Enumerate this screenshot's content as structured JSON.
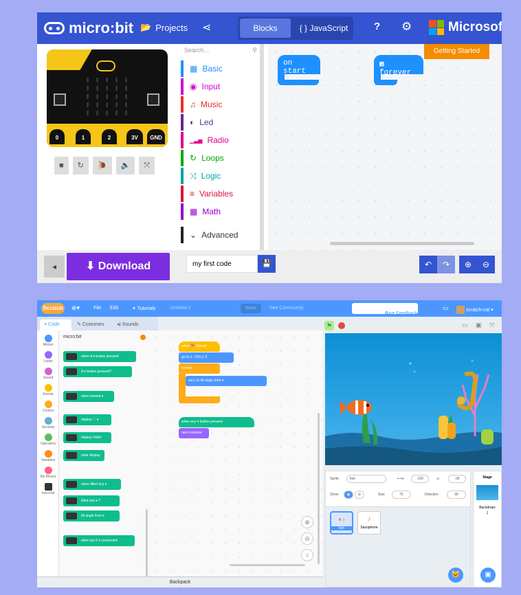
{
  "microbit": {
    "logo": "micro:bit",
    "projects": "Projects",
    "blocks_tab": "Blocks",
    "js_tab": "{ } JavaScript",
    "microsoft": "Microsoft",
    "search_placeholder": "Search...",
    "categories": [
      {
        "label": "Basic",
        "color": "#1e90ff",
        "icon": "▦"
      },
      {
        "label": "Input",
        "color": "#d400d4",
        "icon": "◉"
      },
      {
        "label": "Music",
        "color": "#e63022",
        "icon": "♫"
      },
      {
        "label": "Led",
        "color": "#5c2d91",
        "icon": "◐"
      },
      {
        "label": "Radio",
        "color": "#e3008c",
        "icon": "▁▃▅"
      },
      {
        "label": "Loops",
        "color": "#00aa00",
        "icon": "↻"
      },
      {
        "label": "Logic",
        "color": "#00a4a6",
        "icon": "⤨"
      },
      {
        "label": "Variables",
        "color": "#dc143c",
        "icon": "≡"
      },
      {
        "label": "Math",
        "color": "#9400d3",
        "icon": "▦"
      },
      {
        "label": "Advanced",
        "color": "#444444",
        "icon": "⌄"
      }
    ],
    "on_start": "on start",
    "forever": "forever",
    "getting_started": "Getting Started",
    "download": "⬇ Download",
    "project_name": "my first code",
    "pins": [
      "0",
      "1",
      "2",
      "3V",
      "GND"
    ]
  },
  "scratch": {
    "logo": "Scratch",
    "menu": {
      "file": "File",
      "edit": "Edit",
      "tutorials": "Tutorials",
      "title": "Untitled-1",
      "share": "Share",
      "community": "See Community",
      "feedback": "Give Feedback",
      "user": "scratch-cat"
    },
    "tabs": {
      "code": "Code",
      "costumes": "Costumes",
      "sounds": "Sounds"
    },
    "categories": [
      {
        "label": "Motion",
        "color": "#4c97ff"
      },
      {
        "label": "Looks",
        "color": "#9966ff"
      },
      {
        "label": "Sound",
        "color": "#cf63cf"
      },
      {
        "label": "Events",
        "color": "#ffbf00"
      },
      {
        "label": "Control",
        "color": "#ffab19"
      },
      {
        "label": "Sensing",
        "color": "#5cb1d6"
      },
      {
        "label": "Operators",
        "color": "#59c059"
      },
      {
        "label": "Variables",
        "color": "#ff8c1a"
      },
      {
        "label": "My Blocks",
        "color": "#ff6680"
      },
      {
        "label": "micro:bit",
        "color": "#333333"
      }
    ],
    "palette_title": "micro:bit",
    "palette_blocks": [
      "when A ▾ button pressed",
      "A ▾ button pressed?",
      "when moved ▾",
      "display ♡ ▾",
      "display Hello!",
      "clear display",
      "when tilted any ▾",
      "tilted any ▾ ?",
      "tilt angle front ▾",
      "when pin 0 ▾ connected"
    ],
    "script1": {
      "hat": "when 🏁 clicked",
      "goto": "go to x: -150 y: 0",
      "forever": "forever",
      "sety": "set y to   tilt angle  front ▾"
    },
    "script2": {
      "hat": "when any ▾ button pressed",
      "next": "next costume"
    },
    "backpack": "Backpack",
    "sprite_label": "Sprite",
    "sprite_name": "fish",
    "x_label": "x",
    "x": "-150",
    "y_label": "y",
    "y": "-35",
    "show": "Show",
    "size_label": "Size",
    "size": "75",
    "direction_label": "Direction",
    "direction": "90",
    "sprites": [
      "fish",
      "Saxophone"
    ],
    "stage_label": "Stage",
    "backdrops_label": "Backdrops",
    "backdrops_count": "1"
  }
}
